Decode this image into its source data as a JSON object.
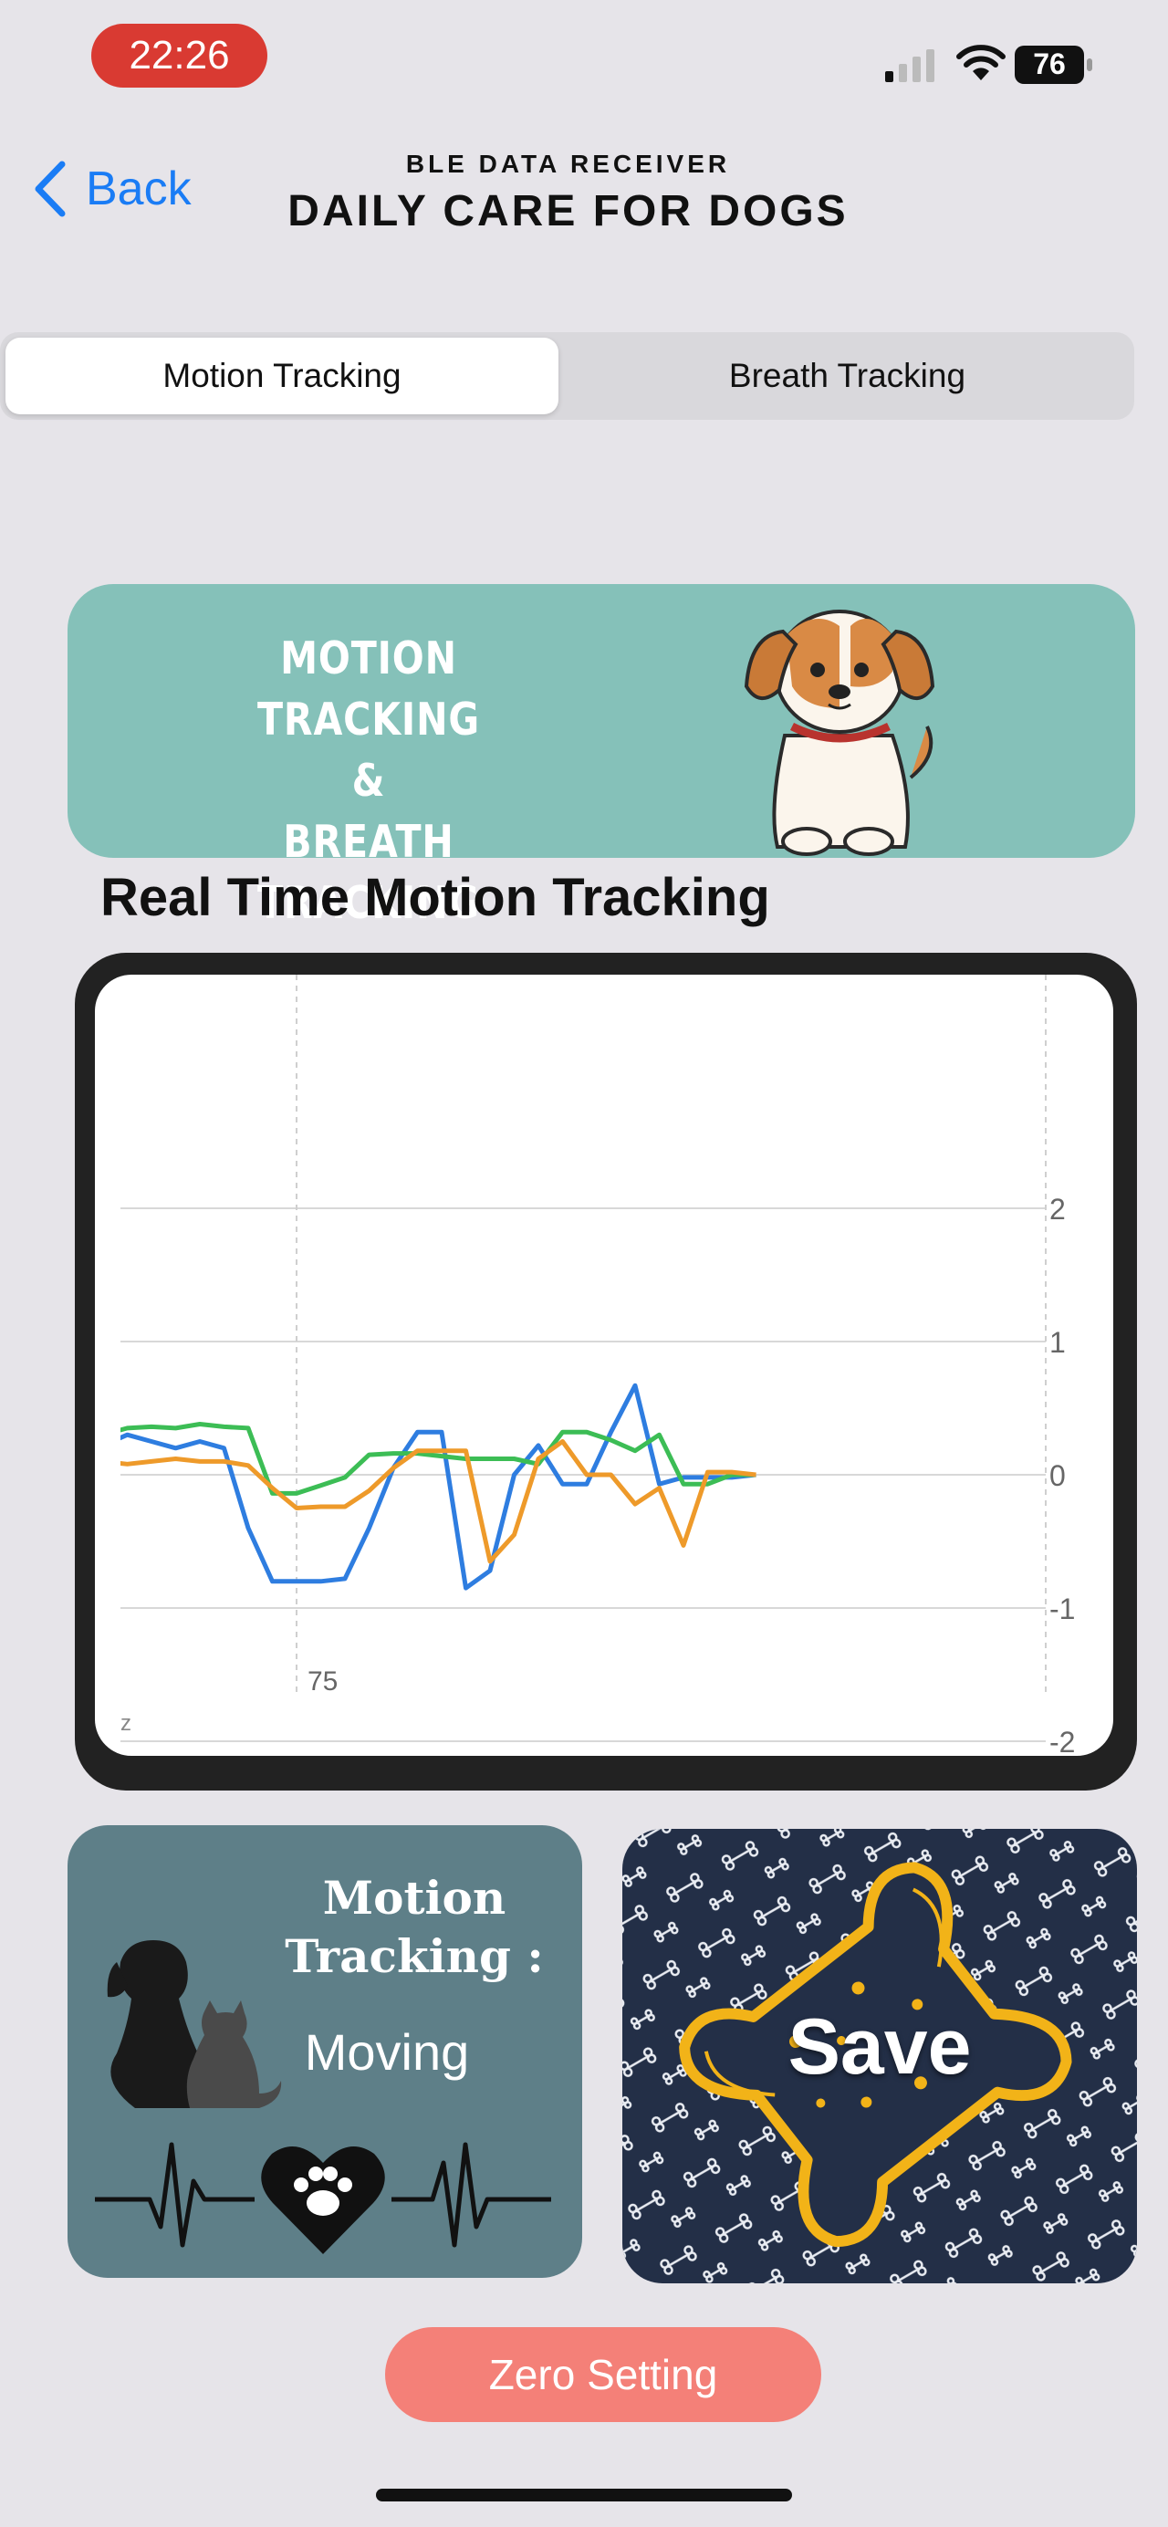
{
  "status_bar": {
    "time": "22:26",
    "battery": "76",
    "icons": [
      "signal-icon",
      "wifi-icon",
      "battery-icon"
    ]
  },
  "nav": {
    "back_label": "Back",
    "subtitle": "BLE DATA RECEIVER",
    "title": "DAILY CARE FOR DOGS"
  },
  "segments": [
    {
      "label": "Motion Tracking",
      "selected": true
    },
    {
      "label": "Breath Tracking",
      "selected": false
    }
  ],
  "banner": {
    "line1": "MOTION TRACKING",
    "line2": "&",
    "line3": "BREATH TRACKING"
  },
  "section_title": "Real Time Motion Tracking",
  "chart_data": {
    "type": "line",
    "x": [
      61,
      62,
      63,
      64,
      65,
      66,
      67,
      68,
      69,
      70,
      71,
      72,
      73,
      74,
      75,
      76,
      77,
      78,
      79,
      80,
      81,
      82,
      83,
      84,
      85,
      86,
      87,
      88,
      89,
      90,
      91,
      92,
      93,
      94
    ],
    "x_tick_labels": [
      "75"
    ],
    "x_ticks": [
      75
    ],
    "xlim": [
      71,
      94
    ],
    "y_tick_labels": [
      "2",
      "1",
      "0",
      "-1",
      "-2"
    ],
    "y_ticks": [
      2,
      1,
      0,
      -1,
      -2
    ],
    "ylim": [
      -2.6,
      2.3
    ],
    "bottom_label": "z",
    "grid": true,
    "series": [
      {
        "color": "#2e7de0",
        "values": [
          0.5,
          0.4,
          0.35,
          0.3,
          0.25,
          0.2,
          0.22,
          0.3,
          0.25,
          0.2,
          0.25,
          0.2,
          -0.4,
          -0.8,
          -0.8,
          -0.8,
          -0.78,
          -0.4,
          0.05,
          0.32,
          0.32,
          -0.85,
          -0.72,
          0.0,
          0.22,
          -0.07,
          -0.07,
          0.32,
          0.67,
          -0.07,
          -0.02,
          -0.02,
          -0.02,
          0.0
        ]
      },
      {
        "color": "#3cbd55",
        "values": [
          0.3,
          0.35,
          0.38,
          0.32,
          0.3,
          0.28,
          0.3,
          0.35,
          0.36,
          0.35,
          0.38,
          0.36,
          0.35,
          -0.14,
          -0.14,
          -0.08,
          -0.02,
          0.15,
          0.16,
          0.16,
          0.14,
          0.12,
          0.12,
          0.12,
          0.08,
          0.32,
          0.32,
          0.26,
          0.18,
          0.3,
          -0.07,
          -0.07,
          0.0,
          0.0
        ]
      },
      {
        "color": "#ee9a2a",
        "values": [
          0.2,
          0.15,
          0.1,
          0.12,
          0.1,
          0.12,
          0.1,
          0.08,
          0.1,
          0.12,
          0.1,
          0.1,
          0.07,
          -0.1,
          -0.25,
          -0.24,
          -0.24,
          -0.12,
          0.05,
          0.18,
          0.18,
          0.18,
          -0.65,
          -0.45,
          0.12,
          0.25,
          0.0,
          0.0,
          -0.22,
          -0.1,
          -0.53,
          0.02,
          0.02,
          0.0
        ]
      }
    ]
  },
  "motion_card": {
    "title": "Motion Tracking :",
    "status": "Moving"
  },
  "save_card": {
    "label": "Save"
  },
  "zero_button": {
    "label": "Zero Setting"
  }
}
